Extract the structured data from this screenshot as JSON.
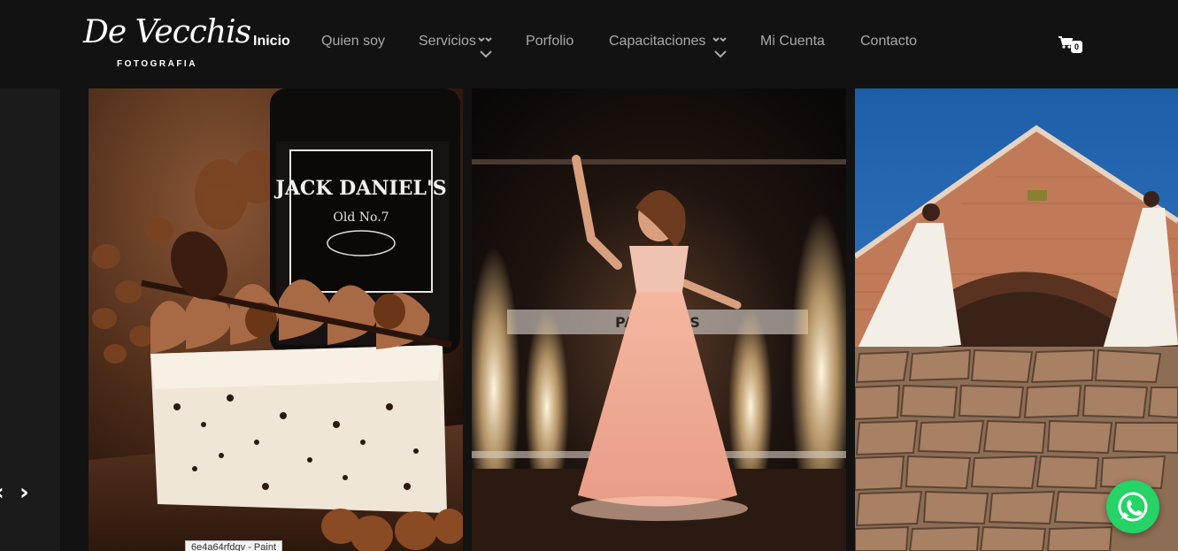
{
  "logo": {
    "script": "De Vecchis",
    "sub": "FOTOGRAFIA"
  },
  "nav": [
    {
      "label": "Inicio",
      "active": true
    },
    {
      "label": "Quien soy"
    },
    {
      "label": "Servicios",
      "dropdown": true
    },
    {
      "label": "Porfolio"
    },
    {
      "label": "Capacitaciones",
      "dropdown": true
    },
    {
      "label": "Mi Cuenta"
    },
    {
      "label": "Contacto"
    }
  ],
  "cart": {
    "icon": "shopping-cart-icon",
    "count": "0"
  },
  "carousel": {
    "prev_icon": "chevron-left-icon",
    "next_icon": "chevron-right-icon",
    "slides": [
      {
        "alt": "dessert with chocolate and hazelnuts, bottle label",
        "bottle_label": "JACK DANIEL'S",
        "bottle_sub": "Old No.7"
      },
      {
        "alt": "girl in pink gown with sparklers",
        "sign_text": "PALMARES"
      },
      {
        "alt": "brides on stone wall under brick arch"
      }
    ]
  },
  "taskbar_tooltip": "6e4a64rfdqv - Paint",
  "whatsapp": {
    "icon": "whatsapp-icon"
  },
  "colors": {
    "background": "#121212",
    "nav_inactive": "#a9a9a9",
    "whatsapp": "#25d366"
  }
}
